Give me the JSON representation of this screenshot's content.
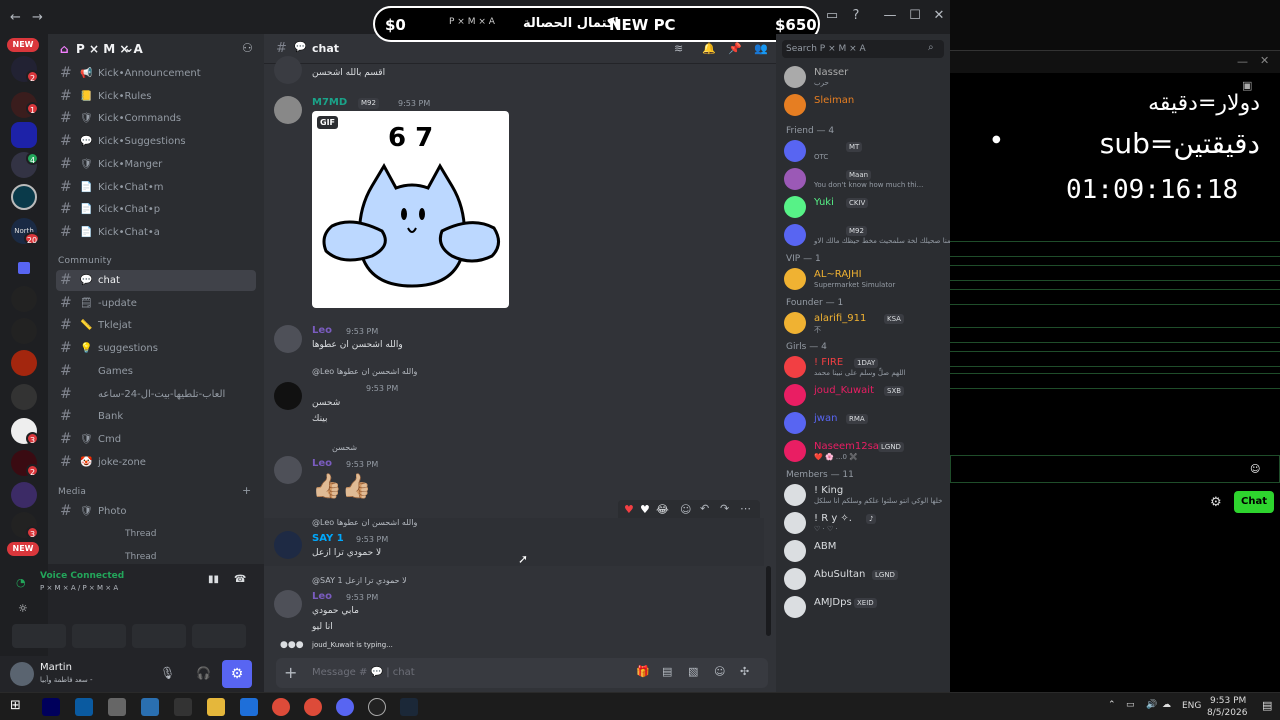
{
  "banner": {
    "left_amount": "$0",
    "server_name": "P × M × A",
    "goal_text_ar": "اكتمال الحصالة",
    "goal_label": "NEW PC",
    "right_amount": "$650"
  },
  "bg_app": {
    "line1": "دولار=دقيقه",
    "line2": "sub=دقيقتين",
    "timer": "01:09:16:18",
    "chat_button": "Chat"
  },
  "rail": {
    "new_top": "NEW",
    "new_bottom": "NEW",
    "counts": [
      "2",
      "1",
      "4",
      "20",
      "3",
      "2",
      "3"
    ],
    "north_label": "North"
  },
  "guild": {
    "name": "P × M × A"
  },
  "channels": [
    {
      "emoji": "📢",
      "label": "Kick•Announcement"
    },
    {
      "emoji": "📒",
      "label": "Kick•Rules"
    },
    {
      "emoji": "🛡",
      "label": "Kick•Commands"
    },
    {
      "emoji": "💬",
      "label": "Kick•Suggestions"
    },
    {
      "emoji": "🛡",
      "label": "Kick•Manger"
    },
    {
      "emoji": "📄",
      "label": "Kick•Chat•m"
    },
    {
      "emoji": "📄",
      "label": "Kick•Chat•p"
    },
    {
      "emoji": "📄",
      "label": "Kick•Chat•a"
    }
  ],
  "community_label": "Community",
  "community_channels": [
    {
      "emoji": "💬",
      "label": "chat"
    },
    {
      "emoji": "🗒",
      "label": "-update"
    },
    {
      "emoji": "📏",
      "label": "Tklejat"
    },
    {
      "emoji": "💡",
      "label": "suggestions"
    },
    {
      "emoji": "",
      "label": "Games"
    },
    {
      "emoji": "",
      "label": "العاب-تلطيها-بيت-ال-24-ساعه"
    },
    {
      "emoji": "",
      "label": "Bank"
    },
    {
      "emoji": "🛡",
      "label": "Cmd"
    },
    {
      "emoji": "🤡",
      "label": "joke-zone"
    }
  ],
  "media_label": "Media",
  "media_channels": [
    {
      "emoji": "🛡",
      "label": "Photo"
    }
  ],
  "threads": [
    "Thread",
    "Thread"
  ],
  "voice": {
    "status": "Voice Connected",
    "location": "P × M × A / P × M × A"
  },
  "user": {
    "name": "Martin",
    "status": "سعد فاطمة وأبيا -"
  },
  "chat": {
    "channel_name": "chat",
    "placeholder": "Message # 💬 | chat",
    "typing": "joud_Kuwait is typing...",
    "messages": {
      "top_text": "اقسم بالله اشحسن",
      "m7md_name": "M7MD",
      "m7md_tag": "M92",
      "m7md_time": "9:53 PM",
      "gif_label": "GIF",
      "gif_text": "6 7",
      "leo1_name": "Leo",
      "leo1_time": "9:53 PM",
      "leo1_text": "والله اشحسن ان عطوها",
      "reply1_text": "@Leo والله اشحسن ان عطوها",
      "m3_time": "9:53 PM",
      "m3_line1": "شحسن",
      "m3_line2": "بينك",
      "reply2_text": "شحسن",
      "leo2_name": "Leo",
      "leo2_time": "9:53 PM",
      "leo2_text": "👍🏼👍🏼",
      "reply3_text": "@Leo والله اشحسن ان عطوها",
      "say1_name": "SAY 1",
      "say1_time": "9:53 PM",
      "say1_text": "لا حمودي ترا ازعل",
      "reply4_text": "@SAY 1 لا حمودي ترا ازعل",
      "leo3_name": "Leo",
      "leo3_time": "9:53 PM",
      "leo3_line1": "مابي حمودي",
      "leo3_line2": "انا ليو"
    }
  },
  "members": {
    "search_placeholder": "Search P × M × A",
    "top": [
      {
        "name": "Nasser",
        "status": "حرب"
      },
      {
        "name": "Sleiman",
        "status": ""
      }
    ],
    "friend_header": "Friend — 4",
    "friends": [
      {
        "name": "",
        "tag": "MT",
        "status": "OTC"
      },
      {
        "name": "",
        "tag": "Maan",
        "status": "You don't know how much thi..."
      },
      {
        "name": "Yuki",
        "tag": "CKIV",
        "status": ""
      },
      {
        "name": "",
        "tag": "M92",
        "status": "وين تكلمنا صحيلك لخة سلمحيث مخط حيظك مالك الاو"
      }
    ],
    "vip_header": "VIP — 1",
    "vip": [
      {
        "name": "AL~RAJHI",
        "status": "Supermarket Simulator"
      }
    ],
    "founder_header": "Founder — 1",
    "founder": [
      {
        "name": "alarifi_911",
        "tag": "KSA",
        "status": "不"
      }
    ],
    "girls_header": "Girls — 4",
    "girls": [
      {
        "name": "! FIRE",
        "tag": "1DAY",
        "status": "اللهم صلِّ وسلم على نبينا محمد"
      },
      {
        "name": "joud_Kuwait",
        "tag": "SXB",
        "status": ""
      },
      {
        "name": "jwan",
        "tag": "RMA",
        "status": ""
      },
      {
        "name": "Naseem12sa",
        "tag": "LGND",
        "status": "❤️ 🌸 ...0 ✖️"
      }
    ],
    "members_header": "Members — 11",
    "members": [
      {
        "name": "! King",
        "tag": "",
        "status": "خلها الوكي انتو سلتوا علكم وسلكم انا سلكل"
      },
      {
        "name": "! R y ✧.",
        "tag": "♪",
        "status": "♡ · ♡ ·"
      },
      {
        "name": "ABM",
        "tag": "",
        "status": ""
      },
      {
        "name": "AbuSultan",
        "tag": "LGND",
        "status": ""
      },
      {
        "name": "AMJDps",
        "tag": "XEID",
        "status": ""
      }
    ]
  },
  "taskbar": {
    "lang": "ENG",
    "time": "9:53 PM",
    "date": "8/5/2026"
  },
  "colors": {
    "accent": "#5865f2",
    "online": "#23a55a",
    "danger": "#da373c",
    "chat_button": "#2ed42e"
  }
}
